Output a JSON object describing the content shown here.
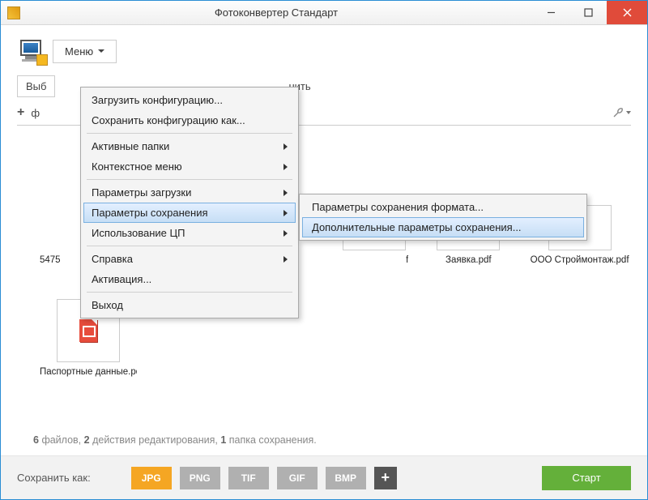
{
  "window": {
    "title": "Фотоконвертер Стандарт"
  },
  "topbar": {
    "menu_label": "Меню"
  },
  "toolbar": {
    "select_prefix": "Выб",
    "action_suffix": "нить",
    "add_prefix": "ф"
  },
  "menu": {
    "load_config": "Загрузить конфигурацию...",
    "save_config": "Сохранить конфигурацию как...",
    "active_folders": "Активные папки",
    "context_menu": "Контекстное меню",
    "load_params": "Параметры загрузки",
    "save_params": "Параметры сохранения",
    "cpu_usage": "Использование ЦП",
    "help": "Справка",
    "activation": "Активация...",
    "exit": "Выход"
  },
  "submenu": {
    "format_save_params": "Параметры сохранения формата...",
    "additional_save_params": "Дополнительные параметры сохранения..."
  },
  "files": {
    "f1": "5475",
    "f2": "f",
    "f3": "Заявка.pdf",
    "f4": "ООО Строймонтаж.pdf",
    "f5": "Паспортные данные.pdf"
  },
  "status": {
    "n_files": "6",
    "files_word": "файлов,",
    "n_actions": "2",
    "actions_word": "действия редактирования,",
    "n_folders": "1",
    "folders_word": "папка сохранения."
  },
  "footer": {
    "save_as_label": "Сохранить как:",
    "jpg": "JPG",
    "png": "PNG",
    "tif": "TIF",
    "gif": "GIF",
    "bmp": "BMP",
    "start": "Старт"
  }
}
